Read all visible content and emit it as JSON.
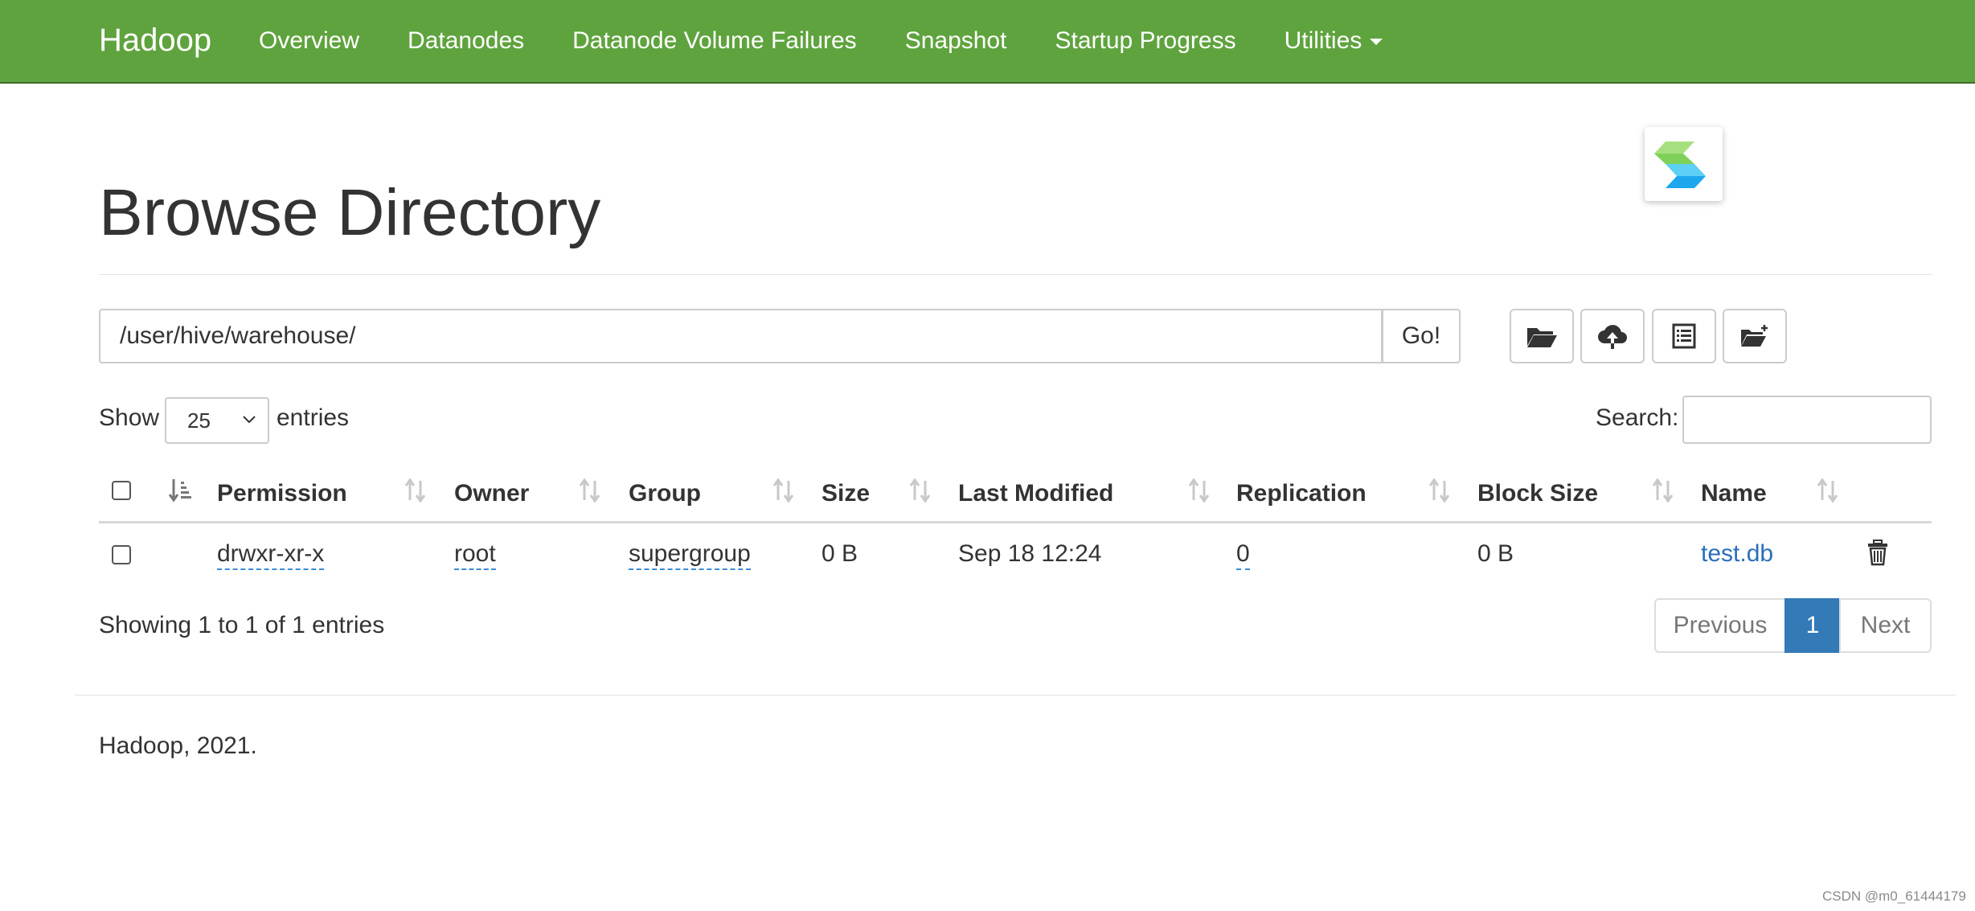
{
  "navbar": {
    "brand": "Hadoop",
    "items": [
      "Overview",
      "Datanodes",
      "Datanode Volume Failures",
      "Snapshot",
      "Startup Progress",
      "Utilities"
    ],
    "bg_color": "#5fa33e"
  },
  "page": {
    "title": "Browse Directory"
  },
  "path_bar": {
    "value": "/user/hive/warehouse/",
    "go_label": "Go!"
  },
  "toolbar": {
    "icons": [
      "folder-open-icon",
      "cloud-upload-icon",
      "list-alt-icon",
      "folder-new-icon"
    ]
  },
  "table_controls": {
    "show_label": "Show",
    "page_size": "25",
    "entries_label": "entries",
    "search_label": "Search:",
    "search_value": ""
  },
  "table": {
    "columns": [
      "Permission",
      "Owner",
      "Group",
      "Size",
      "Last Modified",
      "Replication",
      "Block Size",
      "Name"
    ],
    "rows": [
      {
        "permission": "drwxr-xr-x",
        "owner": "root",
        "group": "supergroup",
        "size": "0 B",
        "last_modified": "Sep 18 12:24",
        "replication": "0",
        "block_size": "0 B",
        "name": "test.db"
      }
    ]
  },
  "pagination": {
    "summary": "Showing 1 to 1 of 1 entries",
    "previous": "Previous",
    "current": "1",
    "next": "Next",
    "active_color": "#337ab7"
  },
  "footer": {
    "text": "Hadoop, 2021."
  },
  "watermark": "CSDN @m0_61444179"
}
